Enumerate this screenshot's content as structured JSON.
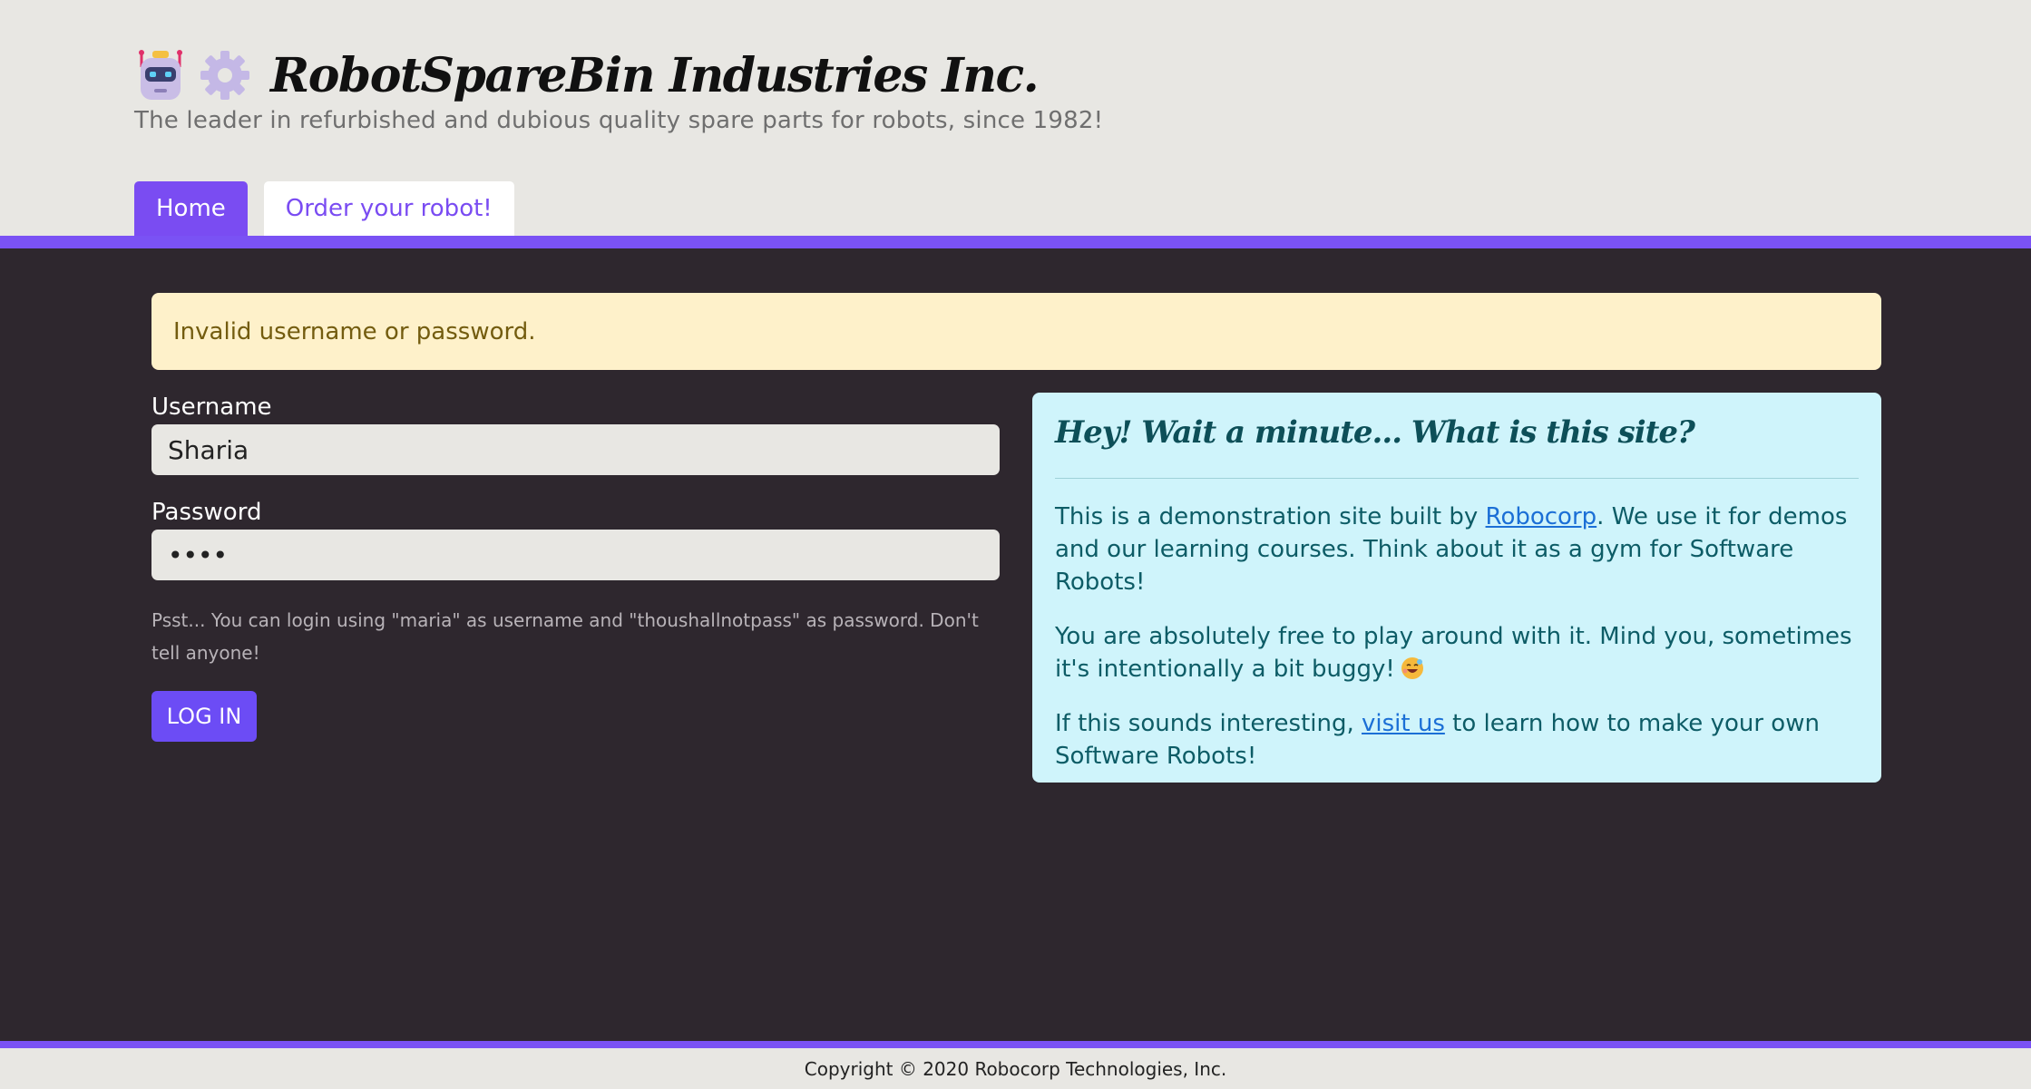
{
  "header": {
    "title": "RobotSpareBin Industries Inc.",
    "tagline": "The leader in refurbished and dubious quality spare parts for robots, since 1982!"
  },
  "nav": {
    "tabs": [
      {
        "label": "Home",
        "active": true
      },
      {
        "label": "Order your robot!",
        "active": false
      }
    ]
  },
  "alert": {
    "message": "Invalid username or password."
  },
  "login_form": {
    "username_label": "Username",
    "username_value": "Sharia",
    "password_label": "Password",
    "password_value": "••••",
    "hint": "Psst... You can login using \"maria\" as username and \"thoushallnotpass\" as password. Don't tell anyone!",
    "login_button": "LOG IN"
  },
  "info_card": {
    "heading": "Hey! Wait a minute... What is this site?",
    "p1_before": "This is a demonstration site built by ",
    "p1_link": "Robocorp",
    "p1_after": ". We use it for demos and our learning courses. Think about it as a gym for Software Robots!",
    "p2": "You are absolutely free to play around with it. Mind you, sometimes it's intentionally a bit buggy!",
    "p3_before": "If this sounds interesting, ",
    "p3_link": "visit us",
    "p3_after": " to learn how to make your own Software Robots!"
  },
  "footer": {
    "copyright": "Copyright © 2020 Robocorp Technologies, Inc."
  },
  "colors": {
    "accent": "#7a52f4",
    "alert_bg": "#fef1ca",
    "info_bg": "#cff4fb",
    "page_bg": "#2e272e"
  },
  "icons": [
    "robot-icon",
    "gear-icon",
    "smiling-sweat-emoji-icon"
  ]
}
